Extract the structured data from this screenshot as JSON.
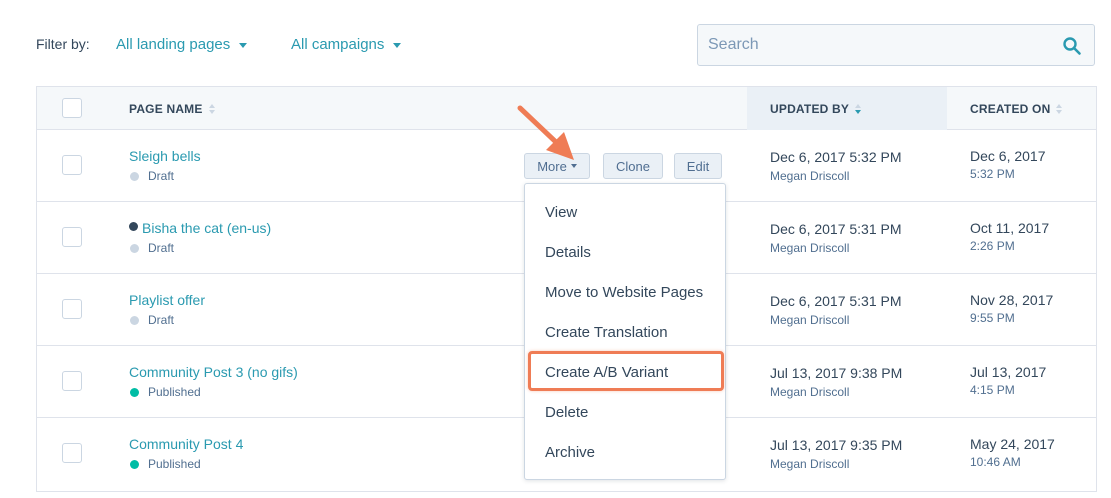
{
  "filters": {
    "label": "Filter by:",
    "landing_pages": "All landing pages",
    "campaigns": "All campaigns"
  },
  "search": {
    "placeholder": "Search"
  },
  "table": {
    "headers": {
      "page_name": "PAGE NAME",
      "updated_by": "UPDATED BY",
      "created_on": "CREATED ON"
    },
    "rows": [
      {
        "name": "Sleigh bells",
        "status": "Draft",
        "updated_date": "Dec 6, 2017 5:32 PM",
        "updated_user": "Megan Driscoll",
        "created_date": "Dec 6, 2017",
        "created_time": "5:32 PM"
      },
      {
        "name": "Bisha the cat (en-us)",
        "status": "Draft",
        "updated_date": "Dec 6, 2017 5:31 PM",
        "updated_user": "Megan Driscoll",
        "created_date": "Oct 11, 2017",
        "created_time": "2:26 PM"
      },
      {
        "name": "Playlist offer",
        "status": "Draft",
        "updated_date": "Dec 6, 2017 5:31 PM",
        "updated_user": "Megan Driscoll",
        "created_date": "Nov 28, 2017",
        "created_time": "9:55 PM"
      },
      {
        "name": "Community Post 3 (no gifs)",
        "status": "Published",
        "updated_date": "Jul 13, 2017 9:38 PM",
        "updated_user": "Megan Driscoll",
        "created_date": "Jul 13, 2017",
        "created_time": "4:15 PM"
      },
      {
        "name": "Community Post 4",
        "status": "Published",
        "updated_date": "Jul 13, 2017 9:35 PM",
        "updated_user": "Megan Driscoll",
        "created_date": "May 24, 2017",
        "created_time": "10:46 AM"
      }
    ]
  },
  "row_actions": {
    "more": "More",
    "clone": "Clone",
    "edit": "Edit"
  },
  "more_menu": {
    "items": [
      "View",
      "Details",
      "Move to Website Pages",
      "Create Translation",
      "Create A/B Variant",
      "Delete",
      "Archive"
    ]
  },
  "colors": {
    "link": "#2a9ab0",
    "draft_dot": "#cbd6e2",
    "published_dot": "#00bda5",
    "highlight": "#ef7c55"
  },
  "icons": {
    "search": "search-icon",
    "arrow": "annotation-arrow-icon",
    "translation": "globe-icon"
  }
}
